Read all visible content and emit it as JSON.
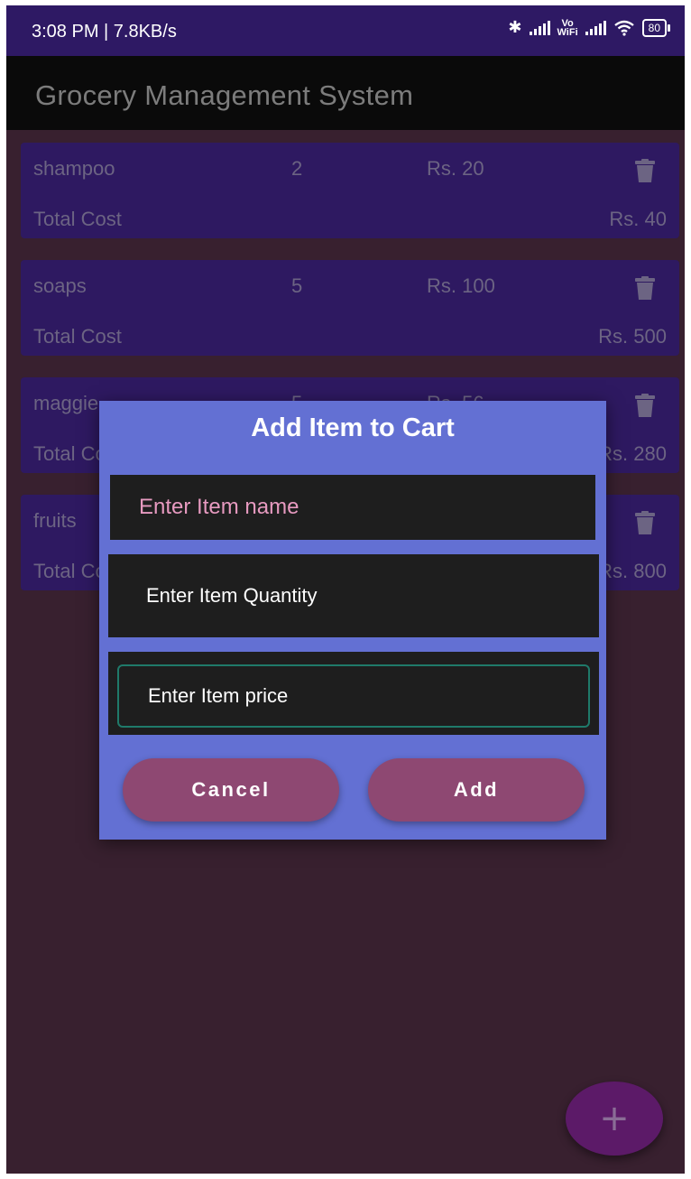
{
  "status_bar": {
    "time": "3:08 PM | 7.8KB/s",
    "vowifi_top": "Vo",
    "vowifi_bottom": "WiFi",
    "battery": "80",
    "icons": [
      "bluetooth-icon",
      "signal-icon",
      "vowifi-icon",
      "signal-icon",
      "wifi-icon",
      "battery-icon"
    ]
  },
  "app_bar": {
    "title": "Grocery Management System"
  },
  "items": [
    {
      "name": "shampoo",
      "quantity": "2",
      "price": "Rs. 20",
      "total_label": "Total Cost",
      "total_value": "Rs. 40"
    },
    {
      "name": "soaps",
      "quantity": "5",
      "price": "Rs. 100",
      "total_label": "Total Cost",
      "total_value": "Rs. 500"
    },
    {
      "name": "maggie",
      "quantity": "5",
      "price": "Rs. 56",
      "total_label": "Total Cost",
      "total_value": "Rs. 280"
    },
    {
      "name": "fruits",
      "quantity": "",
      "price": "",
      "total_label": "Total Cost",
      "total_value": "Rs. 800"
    }
  ],
  "dialog": {
    "title": "Add Item to Cart",
    "name_placeholder": "Enter Item name",
    "quantity_placeholder": "Enter Item Quantity",
    "price_placeholder": "Enter Item price",
    "cancel_label": "Cancel",
    "add_label": "Add"
  },
  "fab": {
    "label": "+",
    "icon": "plus-icon"
  },
  "colors": {
    "background": "#38202f",
    "status_bar": "#2e1964",
    "card": "#2e1961",
    "dialog": "#6370d3",
    "button": "#8e4872",
    "fab": "#5c1a68"
  }
}
